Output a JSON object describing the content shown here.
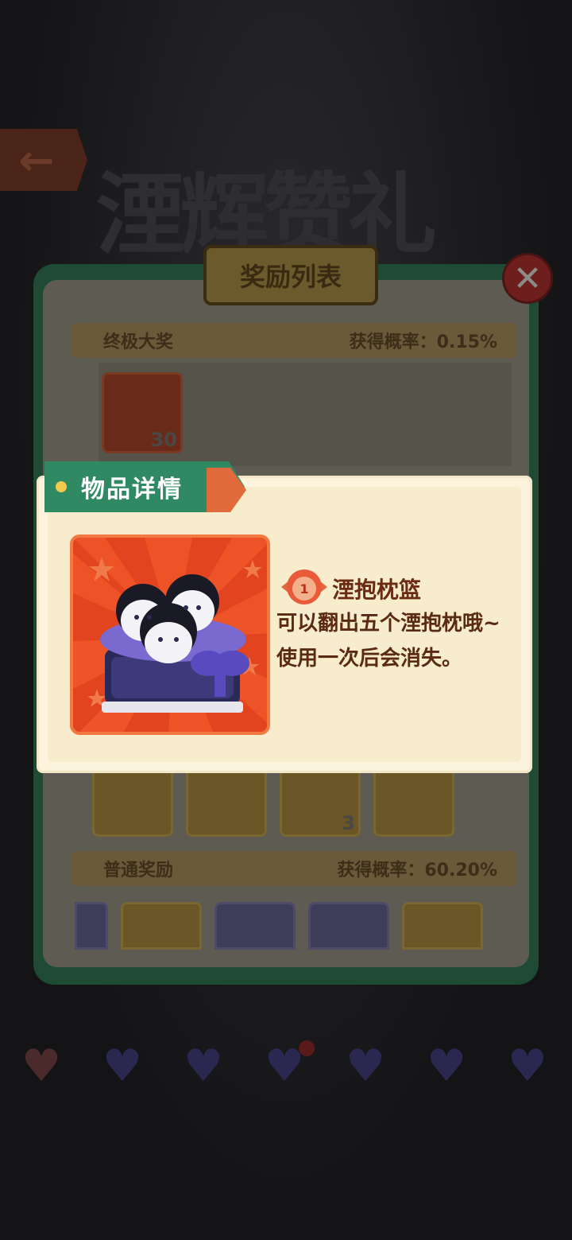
{
  "background": {
    "back_icon": "arrow-left-icon",
    "title": "湮辉赞礼"
  },
  "reward_panel": {
    "title": "奖励列表",
    "close_icon": "close-icon",
    "sections": [
      {
        "name": "终极大奖",
        "rate_label": "获得概率：0.15%"
      },
      {
        "name": "普通奖励",
        "rate_label": "获得概率：60.20%"
      }
    ],
    "grand_prize_qty": "30",
    "row_item_qty": "3"
  },
  "detail_popup": {
    "banner": "物品详情",
    "item_name": "湮抱枕篮",
    "rarity": "1",
    "description": "可以翻出五个湮抱枕哦~\n使用一次后会消失。"
  },
  "hearts": {
    "count": 7,
    "icon": "heart-icon"
  },
  "colors": {
    "panel_green": "#2f8a63",
    "card_red": "#e1441f",
    "popup_bg": "#fbf3dc",
    "text_brown": "#6b2a12"
  }
}
